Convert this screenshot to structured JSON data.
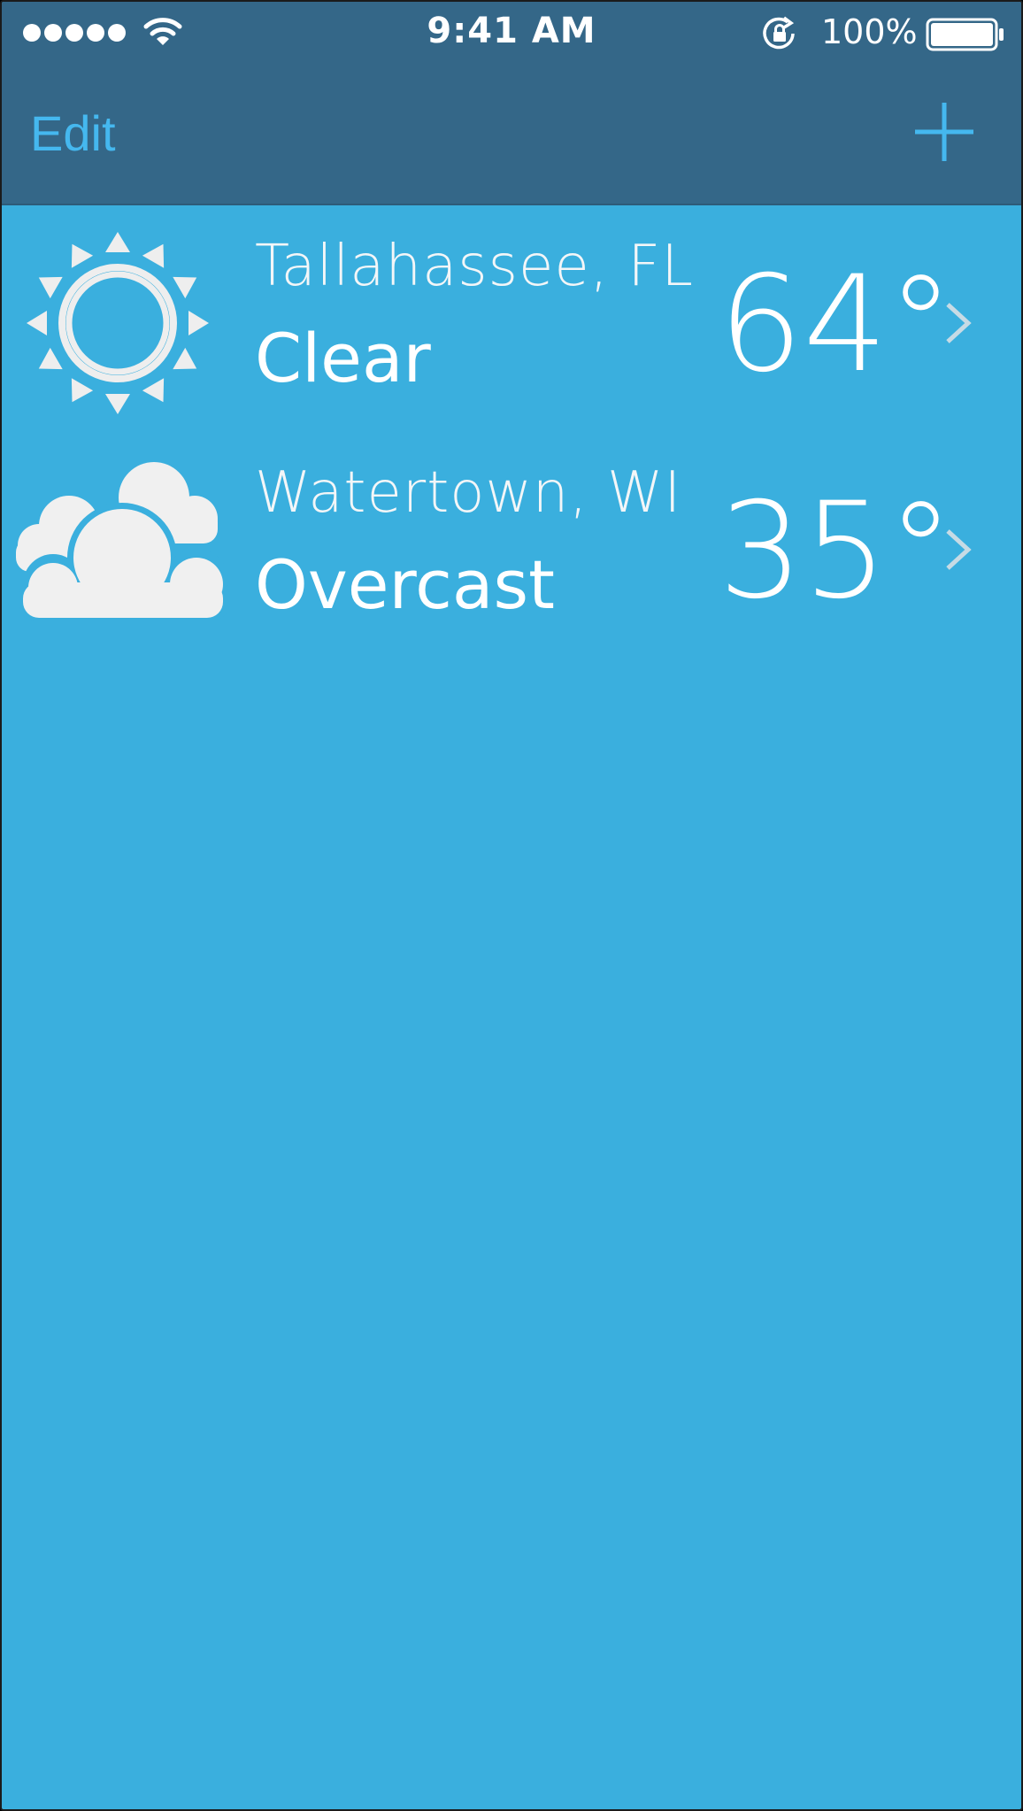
{
  "status_bar": {
    "time": "9:41 AM",
    "battery_percent": "100%",
    "signal_bars": 5,
    "icons": [
      "signal-dots-icon",
      "wifi-icon",
      "orientation-lock-icon",
      "battery-icon"
    ]
  },
  "nav": {
    "edit_label": "Edit",
    "add_icon": "plus-icon"
  },
  "colors": {
    "status_nav_bg": "#346788",
    "list_bg": "#3aafde",
    "accent": "#45b8ef",
    "icon_fill": "#f0f0f0"
  },
  "locations": [
    {
      "city": "Tallahassee, FL",
      "condition": "Clear",
      "temperature": "64°",
      "icon": "sun-icon"
    },
    {
      "city": "Watertown, WI",
      "condition": "Overcast",
      "temperature": "35°",
      "icon": "clouds-icon"
    }
  ]
}
